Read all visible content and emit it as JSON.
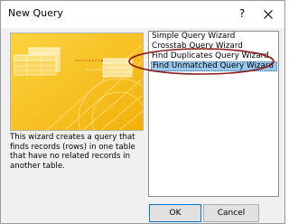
{
  "window": {
    "title": "New Query",
    "help_label": "?"
  },
  "icons": {
    "close": "close-icon",
    "help": "help-icon"
  },
  "description": "This wizard creates a query that finds records (rows) in one table that have no related records in another table.",
  "wizards": [
    {
      "label": "Simple Query Wizard",
      "selected": false
    },
    {
      "label": "Crosstab Query Wizard",
      "selected": false
    },
    {
      "label": "Find Duplicates Query Wizard",
      "selected": false
    },
    {
      "label": "Find Unmatched Query Wizard",
      "selected": true
    }
  ],
  "buttons": {
    "ok_label": "OK",
    "cancel_label": "Cancel"
  },
  "colors": {
    "preview_background": "#f7c21a",
    "selection": "#99c9ef",
    "annotation": "#8b1a1a"
  }
}
